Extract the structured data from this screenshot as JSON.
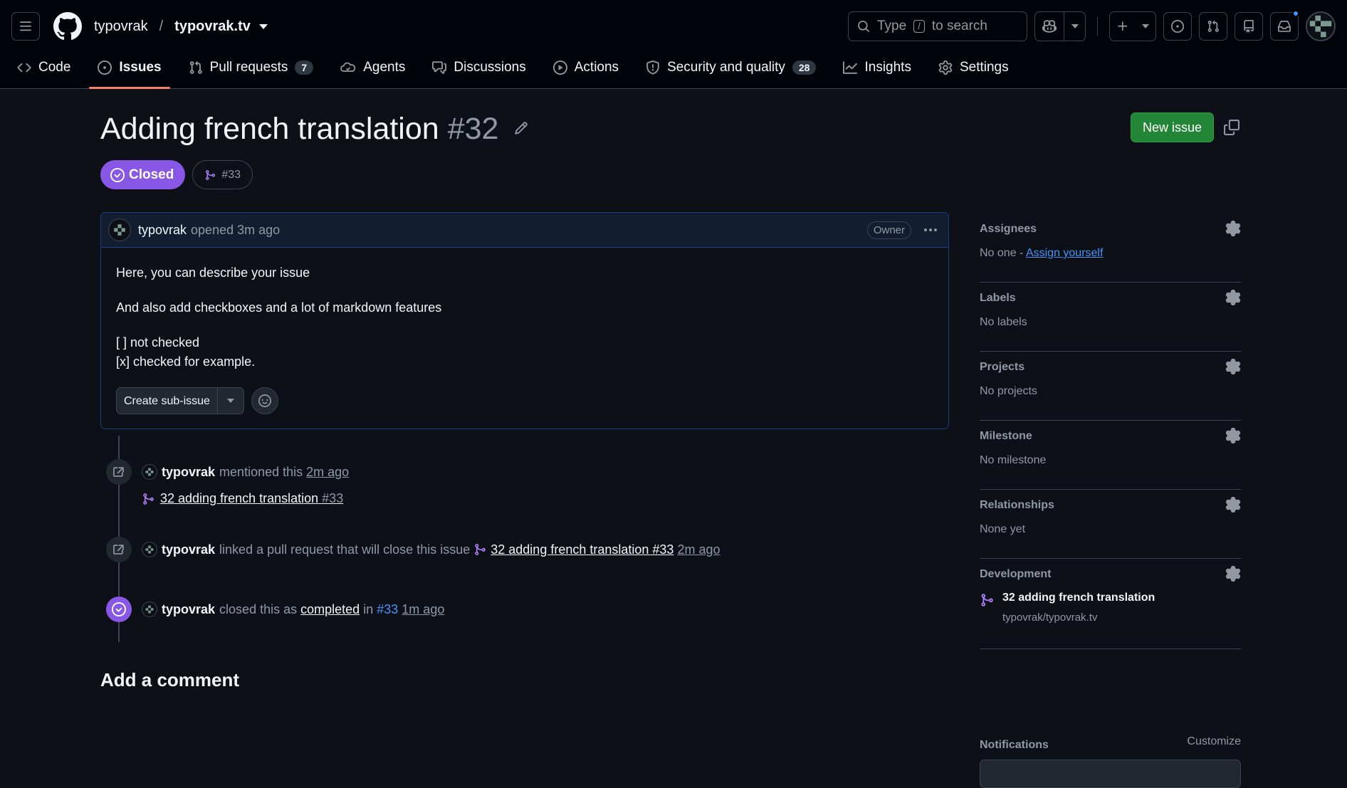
{
  "header": {
    "owner": "typovrak",
    "separator": "/",
    "repo": "typovrak.tv",
    "search_prefix": "Type",
    "search_key": "/",
    "search_suffix": "to search"
  },
  "tabs": [
    {
      "label": "Code",
      "icon": "code-icon"
    },
    {
      "label": "Issues",
      "icon": "issue-opened-icon",
      "active": true
    },
    {
      "label": "Pull requests",
      "icon": "git-pull-request-icon",
      "count": "7"
    },
    {
      "label": "Agents",
      "icon": "agent-icon"
    },
    {
      "label": "Discussions",
      "icon": "comment-discussion-icon"
    },
    {
      "label": "Actions",
      "icon": "play-icon"
    },
    {
      "label": "Security and quality",
      "icon": "shield-icon",
      "count": "28"
    },
    {
      "label": "Insights",
      "icon": "graph-icon"
    },
    {
      "label": "Settings",
      "icon": "gear-icon"
    }
  ],
  "issue": {
    "title": "Adding french translation",
    "number": "#32",
    "state": "Closed",
    "linked_pr": "#33",
    "new_issue_label": "New issue"
  },
  "comment": {
    "author": "typovrak",
    "meta": "opened 3m ago",
    "role": "Owner",
    "body_line1": "Here, you can describe your issue",
    "body_line2": "And also add checkboxes and a lot of markdown features",
    "body_line3": "[ ] not checked",
    "body_line4": "[x] checked for example.",
    "create_subissue_label": "Create sub-issue"
  },
  "timeline": {
    "ev1": {
      "author": "typovrak",
      "action": "mentioned this",
      "time": "2m ago",
      "ref_title": "32 adding french translation",
      "ref_num": "#33"
    },
    "ev2": {
      "author": "typovrak",
      "action": "linked a pull request that will close this issue",
      "ref": "32 adding french translation #33",
      "time": "2m ago"
    },
    "ev3": {
      "author": "typovrak",
      "action": "closed this as",
      "state": "completed",
      "in": "in",
      "pr": "#33",
      "time": "1m ago"
    }
  },
  "sidebar": {
    "assignees": {
      "title": "Assignees",
      "value": "No one -",
      "link": "Assign yourself"
    },
    "labels": {
      "title": "Labels",
      "value": "No labels"
    },
    "projects": {
      "title": "Projects",
      "value": "No projects"
    },
    "milestone": {
      "title": "Milestone",
      "value": "No milestone"
    },
    "relationships": {
      "title": "Relationships",
      "value": "None yet"
    },
    "development": {
      "title": "Development",
      "pr_title": "32 adding french translation",
      "repo": "typovrak/typovrak.tv"
    },
    "notifications": {
      "title": "Notifications",
      "customize": "Customize"
    }
  },
  "add_comment_heading": "Add a comment",
  "colors": {
    "closed": "#8957e5",
    "primary": "#238636",
    "accent": "#f78166",
    "link": "#4493f8"
  }
}
